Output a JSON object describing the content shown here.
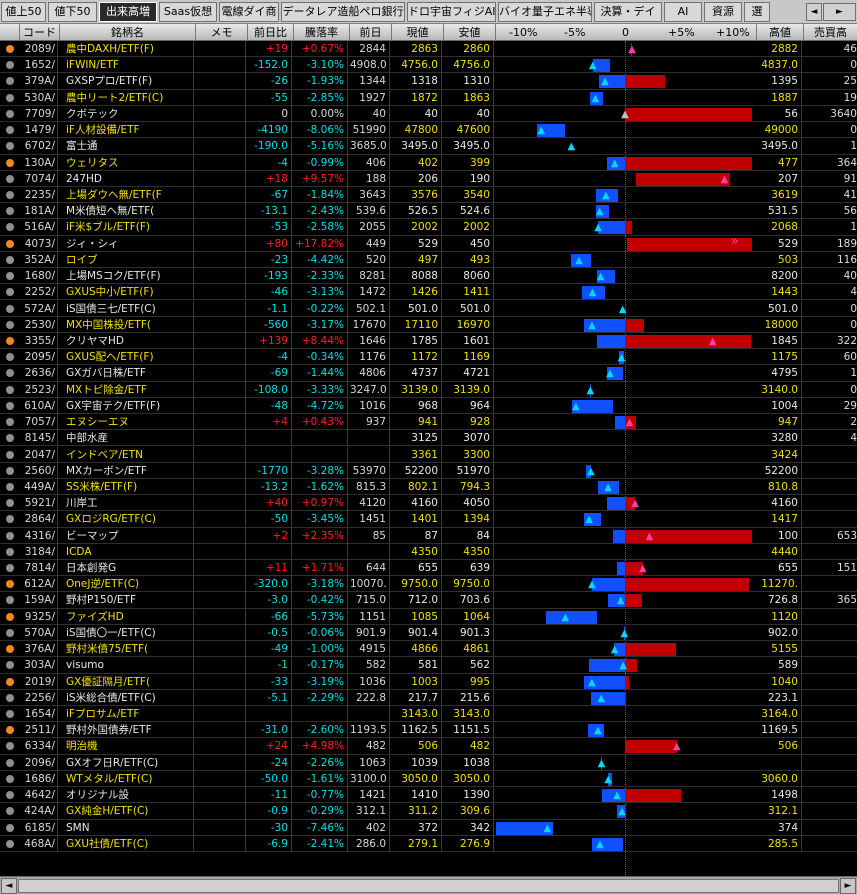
{
  "tabs": [
    "値上50",
    "値下50",
    "出来高増",
    "Saas仮想",
    "電線ダイ商",
    "データレア造船ペロ銀行",
    "ドロ宇宙フィジAI",
    "バイオ量子エネ半導",
    "決算・デイ",
    "AI",
    "資源",
    "選"
  ],
  "active_tab": 2,
  "nav": {
    "prev": "◄",
    "next": "►"
  },
  "columns": {
    "code": "コード",
    "name": "銘柄名",
    "memo": "メモ",
    "chg": "前日比",
    "pct": "騰落率",
    "prev": "前日",
    "cur": "現値",
    "low": "安値",
    "pm10": "-10%",
    "pm5": "-5%",
    "zero": "0",
    "pp5": "+5%",
    "pp10": "+10%",
    "high": "高値",
    "vol": "売買高"
  },
  "scroll": {
    "left": "◄",
    "right": "►"
  },
  "colors": {
    "yellow": "#f0e000",
    "white": "#e8e8e8",
    "red": "#ff2020",
    "cyan": "#00e0e0",
    "blue": "#1050ff",
    "darkred": "#c00000"
  },
  "rows": [
    {
      "dot": "orange",
      "code": "2089/",
      "name": "農中DAXH/ETF(F)",
      "nc": "y",
      "chg": "+19",
      "pct": "+0.67%",
      "prev": "2844",
      "cur": "2863",
      "low": "2860",
      "high": "2882",
      "vol": "46",
      "pos": 0.67,
      "o": 0.56,
      "lo": 0.56,
      "hi": 0.67,
      "mk": "pu"
    },
    {
      "dot": "grey",
      "code": "1652/",
      "name": "iFWIN/ETF",
      "nc": "y",
      "chg": "-152.0",
      "pct": "-3.10%",
      "prev": "4908.0",
      "cur": "4756.0",
      "low": "4756.0",
      "high": "4837.0",
      "vol": "0",
      "pos": -3.1,
      "o": -1.45,
      "lo": -3.1,
      "hi": -1.45,
      "mk": "cu"
    },
    {
      "dot": "grey",
      "code": "379A/",
      "name": "GXSPプロ/ETF(F)",
      "nc": "w",
      "chg": "-26",
      "pct": "-1.93%",
      "prev": "1344",
      "cur": "1318",
      "low": "1310",
      "high": "1395",
      "vol": "25",
      "pos": -1.93,
      "o": 3.8,
      "lo": -2.53,
      "hi": 3.8,
      "mk": "cu"
    },
    {
      "dot": "grey",
      "code": "530A/",
      "name": "農中リート2/ETF(C)",
      "nc": "y",
      "chg": "-55",
      "pct": "-2.85%",
      "prev": "1927",
      "cur": "1872",
      "low": "1863",
      "high": "1887",
      "vol": "19",
      "pos": -2.85,
      "o": -2.08,
      "lo": -3.32,
      "hi": -2.08,
      "mk": "cu"
    },
    {
      "dot": "grey",
      "code": "7709/",
      "name": "クボテック",
      "nc": "w",
      "chg": "0",
      "pct": "0.00%",
      "prev": "40",
      "cur": "40",
      "low": "40",
      "high": "56",
      "vol": "3640",
      "pos": 0.0,
      "o": 0.0,
      "lo": 0.0,
      "hi": 40.0,
      "mk": "gu"
    },
    {
      "dot": "grey",
      "code": "1479/",
      "name": "iF人材設備/ETF",
      "nc": "y",
      "chg": "-4190",
      "pct": "-8.06%",
      "prev": "51990",
      "cur": "47800",
      "low": "47600",
      "high": "49000",
      "vol": "0",
      "pos": -8.06,
      "o": -5.75,
      "lo": -8.44,
      "hi": -5.75,
      "mk": "cu"
    },
    {
      "dot": "grey",
      "code": "6702/",
      "name": "富士通",
      "nc": "w",
      "chg": "-190.0",
      "pct": "-5.16%",
      "prev": "3685.0",
      "cur": "3495.0",
      "low": "3495.0",
      "high": "3495.0",
      "vol": "1",
      "pos": -5.16,
      "o": -5.16,
      "lo": -5.16,
      "hi": -5.16,
      "mk": "cu"
    },
    {
      "dot": "orange",
      "code": "130A/",
      "name": "ウェリタス",
      "nc": "y",
      "chg": "-4",
      "pct": "-0.99%",
      "prev": "406",
      "cur": "402",
      "low": "399",
      "high": "477",
      "vol": "364",
      "pos": -0.99,
      "o": 17.49,
      "lo": -1.72,
      "hi": 17.49,
      "mk": "cu"
    },
    {
      "dot": "grey",
      "code": "7074/",
      "name": "247HD",
      "nc": "w",
      "chg": "+18",
      "pct": "+9.57%",
      "prev": "188",
      "cur": "206",
      "low": "190",
      "high": "207",
      "vol": "91",
      "pos": 9.57,
      "o": 1.06,
      "lo": 1.06,
      "hi": 10.11,
      "mk": "pu"
    },
    {
      "dot": "grey",
      "code": "2235/",
      "name": "上場ダウヘ無/ETF(F",
      "nc": "y",
      "chg": "-67",
      "pct": "-1.84%",
      "prev": "3643",
      "cur": "3576",
      "low": "3540",
      "high": "3619",
      "vol": "41",
      "pos": -1.84,
      "o": -0.66,
      "lo": -2.83,
      "hi": -0.66,
      "mk": "cu"
    },
    {
      "dot": "grey",
      "code": "181A/",
      "name": "M米債短ヘ無/ETF(",
      "nc": "w",
      "chg": "-13.1",
      "pct": "-2.43%",
      "prev": "539.6",
      "cur": "526.5",
      "low": "524.6",
      "high": "531.5",
      "vol": "56",
      "pos": -2.43,
      "o": -1.5,
      "lo": -2.78,
      "hi": -1.5,
      "mk": "cu"
    },
    {
      "dot": "grey",
      "code": "516A/",
      "name": "iF米$ブル/ETF(F)",
      "nc": "y",
      "chg": "-53",
      "pct": "-2.58%",
      "prev": "2055",
      "cur": "2002",
      "low": "2002",
      "high": "2068",
      "vol": "1",
      "pos": -2.58,
      "o": 0.63,
      "lo": -2.58,
      "hi": 0.63,
      "mk": "cu"
    },
    {
      "dot": "orange",
      "code": "4073/",
      "name": "ジィ・シィ",
      "nc": "w",
      "chg": "+80",
      "pct": "+17.82%",
      "prev": "449",
      "cur": "529",
      "low": "450",
      "high": "529",
      "vol": "189",
      "pos": 17.82,
      "o": 0.22,
      "lo": 0.22,
      "hi": 17.82,
      "mk": "dbl"
    },
    {
      "dot": "grey",
      "code": "352A/",
      "name": "ロイブ",
      "nc": "y",
      "chg": "-23",
      "pct": "-4.42%",
      "prev": "520",
      "cur": "497",
      "low": "493",
      "high": "503",
      "vol": "116",
      "pos": -4.42,
      "o": -3.27,
      "lo": -5.19,
      "hi": -3.27,
      "mk": "cu"
    },
    {
      "dot": "grey",
      "code": "1680/",
      "name": "上場MSコク/ETF(F)",
      "nc": "w",
      "chg": "-193",
      "pct": "-2.33%",
      "prev": "8281",
      "cur": "8088",
      "low": "8060",
      "high": "8200",
      "vol": "40",
      "pos": -2.33,
      "o": -0.98,
      "lo": -2.67,
      "hi": -0.98,
      "mk": "cu"
    },
    {
      "dot": "grey",
      "code": "2252/",
      "name": "GXUS中小/ETF(F)",
      "nc": "y",
      "chg": "-46",
      "pct": "-3.13%",
      "prev": "1472",
      "cur": "1426",
      "low": "1411",
      "high": "1443",
      "vol": "4",
      "pos": -3.13,
      "o": -1.97,
      "lo": -4.14,
      "hi": -1.97,
      "mk": "cu"
    },
    {
      "dot": "grey",
      "code": "572A/",
      "name": "iS国債三七/ETF(C)",
      "nc": "w",
      "chg": "-1.1",
      "pct": "-0.22%",
      "prev": "502.1",
      "cur": "501.0",
      "low": "501.0",
      "high": "501.0",
      "vol": "0",
      "pos": -0.22,
      "o": -0.22,
      "lo": -0.22,
      "hi": -0.22,
      "mk": "cu"
    },
    {
      "dot": "grey",
      "code": "2530/",
      "name": "MX中国株投/ETF(",
      "nc": "y",
      "chg": "-560",
      "pct": "-3.17%",
      "prev": "17670",
      "cur": "17110",
      "low": "16970",
      "high": "18000",
      "vol": "0",
      "pos": -3.17,
      "o": 1.87,
      "lo": -3.96,
      "hi": 1.87,
      "mk": "cu"
    },
    {
      "dot": "orange",
      "code": "3355/",
      "name": "クリヤマHD",
      "nc": "w",
      "chg": "+139",
      "pct": "+8.44%",
      "prev": "1646",
      "cur": "1785",
      "low": "1601",
      "high": "1845",
      "vol": "322",
      "pos": 8.44,
      "o": -2.73,
      "lo": -2.73,
      "hi": 12.09,
      "mk": "pu"
    },
    {
      "dot": "grey",
      "code": "2095/",
      "name": "GXUS配ヘ/ETF(F)",
      "nc": "y",
      "chg": "-4",
      "pct": "-0.34%",
      "prev": "1176",
      "cur": "1172",
      "low": "1169",
      "high": "1175",
      "vol": "60",
      "pos": -0.34,
      "o": -0.09,
      "lo": -0.6,
      "hi": -0.09,
      "mk": "cu"
    },
    {
      "dot": "grey",
      "code": "2636/",
      "name": "GXガバ日株/ETF",
      "nc": "w",
      "chg": "-69",
      "pct": "-1.44%",
      "prev": "4806",
      "cur": "4737",
      "low": "4721",
      "high": "4795",
      "vol": "1",
      "pos": -1.44,
      "o": -0.23,
      "lo": -1.77,
      "hi": -0.23,
      "mk": "cu"
    },
    {
      "dot": "grey",
      "code": "2523/",
      "name": "MXトピ除金/ETF",
      "nc": "y",
      "chg": "-108.0",
      "pct": "-3.33%",
      "prev": "3247.0",
      "cur": "3139.0",
      "low": "3139.0",
      "high": "3140.0",
      "vol": "0",
      "pos": -3.33,
      "o": -3.3,
      "lo": -3.33,
      "hi": -3.3,
      "mk": "cu"
    },
    {
      "dot": "grey",
      "code": "610A/",
      "name": "GX宇宙テク/ETF(F)",
      "nc": "w",
      "chg": "-48",
      "pct": "-4.72%",
      "prev": "1016",
      "cur": "968",
      "low": "964",
      "high": "1004",
      "vol": "29",
      "pos": -4.72,
      "o": -1.18,
      "lo": -5.12,
      "hi": -1.18,
      "mk": "cu"
    },
    {
      "dot": "grey",
      "code": "7057/",
      "name": "エヌシーエヌ",
      "nc": "y",
      "chg": "+4",
      "pct": "+0.43%",
      "prev": "937",
      "cur": "941",
      "low": "928",
      "high": "947",
      "vol": "2",
      "pos": 0.43,
      "o": -0.96,
      "lo": -0.96,
      "hi": 1.07,
      "mk": "pu"
    },
    {
      "dot": "grey",
      "code": "8145/",
      "name": "中部水産",
      "nc": "w",
      "chg": "",
      "pct": "",
      "prev": "",
      "cur": "3125",
      "low": "3070",
      "high": "3280",
      "vol": "4",
      "pos": null,
      "o": null,
      "lo": null,
      "hi": null,
      "mk": ""
    },
    {
      "dot": "grey",
      "code": "2047/",
      "name": "インドベア/ETN",
      "nc": "y",
      "chg": "",
      "pct": "",
      "prev": "",
      "cur": "3361",
      "low": "3300",
      "high": "3424",
      "vol": "",
      "pos": null,
      "o": null,
      "lo": null,
      "hi": null,
      "mk": ""
    },
    {
      "dot": "grey",
      "code": "2560/",
      "name": "MXカーボン/ETF",
      "nc": "w",
      "chg": "-1770",
      "pct": "-3.28%",
      "prev": "53970",
      "cur": "52200",
      "low": "51970",
      "high": "52200",
      "vol": "",
      "pos": -3.28,
      "o": -3.28,
      "lo": -3.71,
      "hi": -3.28,
      "mk": "cu"
    },
    {
      "dot": "grey",
      "code": "449A/",
      "name": "SS米株/ETF(F)",
      "nc": "y",
      "chg": "-13.2",
      "pct": "-1.62%",
      "prev": "815.3",
      "cur": "802.1",
      "low": "794.3",
      "high": "810.8",
      "vol": "",
      "pos": -1.62,
      "o": -0.55,
      "lo": -2.58,
      "hi": -0.55,
      "mk": "cu"
    },
    {
      "dot": "grey",
      "code": "5921/",
      "name": "川岸工",
      "nc": "w",
      "chg": "+40",
      "pct": "+0.97%",
      "prev": "4120",
      "cur": "4160",
      "low": "4050",
      "high": "4160",
      "vol": "",
      "pos": 0.97,
      "o": -1.7,
      "lo": -1.7,
      "hi": 0.97,
      "mk": "pu"
    },
    {
      "dot": "grey",
      "code": "2864/",
      "name": "GXロジRG/ETF(C)",
      "nc": "y",
      "chg": "-50",
      "pct": "-3.45%",
      "prev": "1451",
      "cur": "1401",
      "low": "1394",
      "high": "1417",
      "vol": "",
      "pos": -3.45,
      "o": -2.34,
      "lo": -3.93,
      "hi": -2.34,
      "mk": "cu"
    },
    {
      "dot": "grey",
      "code": "4316/",
      "name": "ビーマップ",
      "nc": "w",
      "chg": "+2",
      "pct": "+2.35%",
      "prev": "85",
      "cur": "87",
      "low": "84",
      "high": "100",
      "vol": "653",
      "pos": 2.35,
      "o": 17.65,
      "lo": -1.18,
      "hi": 17.65,
      "mk": "pu"
    },
    {
      "dot": "grey",
      "code": "3184/",
      "name": "ICDA",
      "nc": "y",
      "chg": "",
      "pct": "",
      "prev": "",
      "cur": "4350",
      "low": "4350",
      "high": "4440",
      "vol": "",
      "pos": null,
      "o": null,
      "lo": null,
      "hi": null,
      "mk": ""
    },
    {
      "dot": "grey",
      "code": "7814/",
      "name": "日本創発G",
      "nc": "w",
      "chg": "+11",
      "pct": "+1.71%",
      "prev": "644",
      "cur": "655",
      "low": "639",
      "high": "655",
      "vol": "151",
      "pos": 1.71,
      "o": -0.78,
      "lo": -0.78,
      "hi": 1.71,
      "mk": "pu"
    },
    {
      "dot": "orange",
      "code": "612A/",
      "name": "OneJ逆/ETF(C)",
      "nc": "y",
      "chg": "-320.0",
      "pct": "-3.18%",
      "prev": "10070.",
      "cur": "9750.0",
      "low": "9750.0",
      "high": "11270.",
      "vol": "",
      "pos": -3.18,
      "o": 11.92,
      "lo": -3.18,
      "hi": 11.92,
      "mk": "cu"
    },
    {
      "dot": "grey",
      "code": "159A/",
      "name": "野村P150/ETF",
      "nc": "w",
      "chg": "-3.0",
      "pct": "-0.42%",
      "prev": "715.0",
      "cur": "712.0",
      "low": "703.6",
      "high": "726.8",
      "vol": "365",
      "pos": -0.42,
      "o": 1.65,
      "lo": -1.59,
      "hi": 1.65,
      "mk": "cu"
    },
    {
      "dot": "orange",
      "code": "9325/",
      "name": "ファイズHD",
      "nc": "y",
      "chg": "-66",
      "pct": "-5.73%",
      "prev": "1151",
      "cur": "1085",
      "low": "1064",
      "high": "1120",
      "vol": "",
      "pos": -5.73,
      "o": -2.69,
      "lo": -7.56,
      "hi": -2.69,
      "mk": "cu"
    },
    {
      "dot": "grey",
      "code": "570A/",
      "name": "iS国債〇一/ETF(C)",
      "nc": "w",
      "chg": "-0.5",
      "pct": "-0.06%",
      "prev": "901.9",
      "cur": "901.4",
      "low": "901.3",
      "high": "902.0",
      "vol": "",
      "pos": -0.06,
      "o": 0.01,
      "lo": -0.07,
      "hi": 0.01,
      "mk": "cu"
    },
    {
      "dot": "orange",
      "code": "376A/",
      "name": "野村米債75/ETF(",
      "nc": "y",
      "chg": "-49",
      "pct": "-1.00%",
      "prev": "4915",
      "cur": "4866",
      "low": "4861",
      "high": "5155",
      "vol": "",
      "pos": -1.0,
      "o": 4.88,
      "lo": -1.1,
      "hi": 4.88,
      "mk": "cu"
    },
    {
      "dot": "grey",
      "code": "303A/",
      "name": "visumo",
      "nc": "w",
      "chg": "-1",
      "pct": "-0.17%",
      "prev": "582",
      "cur": "581",
      "low": "562",
      "high": "589",
      "vol": "",
      "pos": -0.17,
      "o": 1.2,
      "lo": -3.44,
      "hi": 1.2,
      "mk": "cu"
    },
    {
      "dot": "orange",
      "code": "2019/",
      "name": "GX優証隔月/ETF(",
      "nc": "y",
      "chg": "-33",
      "pct": "-3.19%",
      "prev": "1036",
      "cur": "1003",
      "low": "995",
      "high": "1040",
      "vol": "",
      "pos": -3.19,
      "o": 0.39,
      "lo": -3.96,
      "hi": 0.39,
      "mk": "cu"
    },
    {
      "dot": "grey",
      "code": "2256/",
      "name": "iS米総合債/ETF(C)",
      "nc": "w",
      "chg": "-5.1",
      "pct": "-2.29%",
      "prev": "222.8",
      "cur": "217.7",
      "low": "215.6",
      "high": "223.1",
      "vol": "",
      "pos": -2.29,
      "o": 0.13,
      "lo": -3.23,
      "hi": 0.13,
      "mk": "cu"
    },
    {
      "dot": "grey",
      "code": "1654/",
      "name": "iFプロサム/ETF",
      "nc": "y",
      "chg": "",
      "pct": "",
      "prev": "",
      "cur": "3143.0",
      "low": "3143.0",
      "high": "3164.0",
      "vol": "",
      "pos": null,
      "o": null,
      "lo": null,
      "hi": null,
      "mk": ""
    },
    {
      "dot": "orange",
      "code": "2511/",
      "name": "野村外国債券/ETF",
      "nc": "w",
      "chg": "-31.0",
      "pct": "-2.60%",
      "prev": "1193.5",
      "cur": "1162.5",
      "low": "1151.5",
      "high": "1169.5",
      "vol": "",
      "pos": -2.6,
      "o": -2.01,
      "lo": -3.52,
      "hi": -2.01,
      "mk": "cu"
    },
    {
      "dot": "grey",
      "code": "6334/",
      "name": "明治機",
      "nc": "y",
      "chg": "+24",
      "pct": "+4.98%",
      "prev": "482",
      "cur": "506",
      "low": "482",
      "high": "506",
      "vol": "",
      "pos": 4.98,
      "o": 0.0,
      "lo": 0.0,
      "hi": 4.98,
      "mk": "pu"
    },
    {
      "dot": "grey",
      "code": "2096/",
      "name": "GXオフ日R/ETF(C)",
      "nc": "w",
      "chg": "-24",
      "pct": "-2.26%",
      "prev": "1063",
      "cur": "1039",
      "low": "1038",
      "high": "",
      "vol": "",
      "pos": -2.26,
      "o": -2.26,
      "lo": -2.35,
      "hi": -2.26,
      "mk": "cu"
    },
    {
      "dot": "grey",
      "code": "1686/",
      "name": "WTメタル/ETF(C)",
      "nc": "y",
      "chg": "-50.0",
      "pct": "-1.61%",
      "prev": "3100.0",
      "cur": "3050.0",
      "low": "3050.0",
      "high": "3060.0",
      "vol": "",
      "pos": -1.61,
      "o": -1.29,
      "lo": -1.61,
      "hi": -1.29,
      "mk": "cu"
    },
    {
      "dot": "grey",
      "code": "4642/",
      "name": "オリジナル設",
      "nc": "w",
      "chg": "-11",
      "pct": "-0.77%",
      "prev": "1421",
      "cur": "1410",
      "low": "1390",
      "high": "1498",
      "vol": "",
      "pos": -0.77,
      "o": 5.42,
      "lo": -2.18,
      "hi": 5.42,
      "mk": "cu"
    },
    {
      "dot": "grey",
      "code": "424A/",
      "name": "GX純金H/ETF(C)",
      "nc": "y",
      "chg": "-0.9",
      "pct": "-0.29%",
      "prev": "312.1",
      "cur": "311.2",
      "low": "309.6",
      "high": "312.1",
      "vol": "",
      "pos": -0.29,
      "o": 0.0,
      "lo": -0.8,
      "hi": 0.0,
      "mk": "cu"
    },
    {
      "dot": "grey",
      "code": "6185/",
      "name": "SMN",
      "nc": "w",
      "chg": "-30",
      "pct": "-7.46%",
      "prev": "402",
      "cur": "372",
      "low": "342",
      "high": "374",
      "vol": "",
      "pos": -7.46,
      "o": -6.97,
      "lo": -14.93,
      "hi": -6.97,
      "mk": "cu"
    },
    {
      "dot": "grey",
      "code": "468A/",
      "name": "GXU社債/ETF(C)",
      "nc": "y",
      "chg": "-6.9",
      "pct": "-2.41%",
      "prev": "286.0",
      "cur": "279.1",
      "low": "276.9",
      "high": "285.5",
      "vol": "",
      "pos": -2.41,
      "o": -0.17,
      "lo": -3.18,
      "hi": -0.17,
      "mk": "cu"
    }
  ]
}
